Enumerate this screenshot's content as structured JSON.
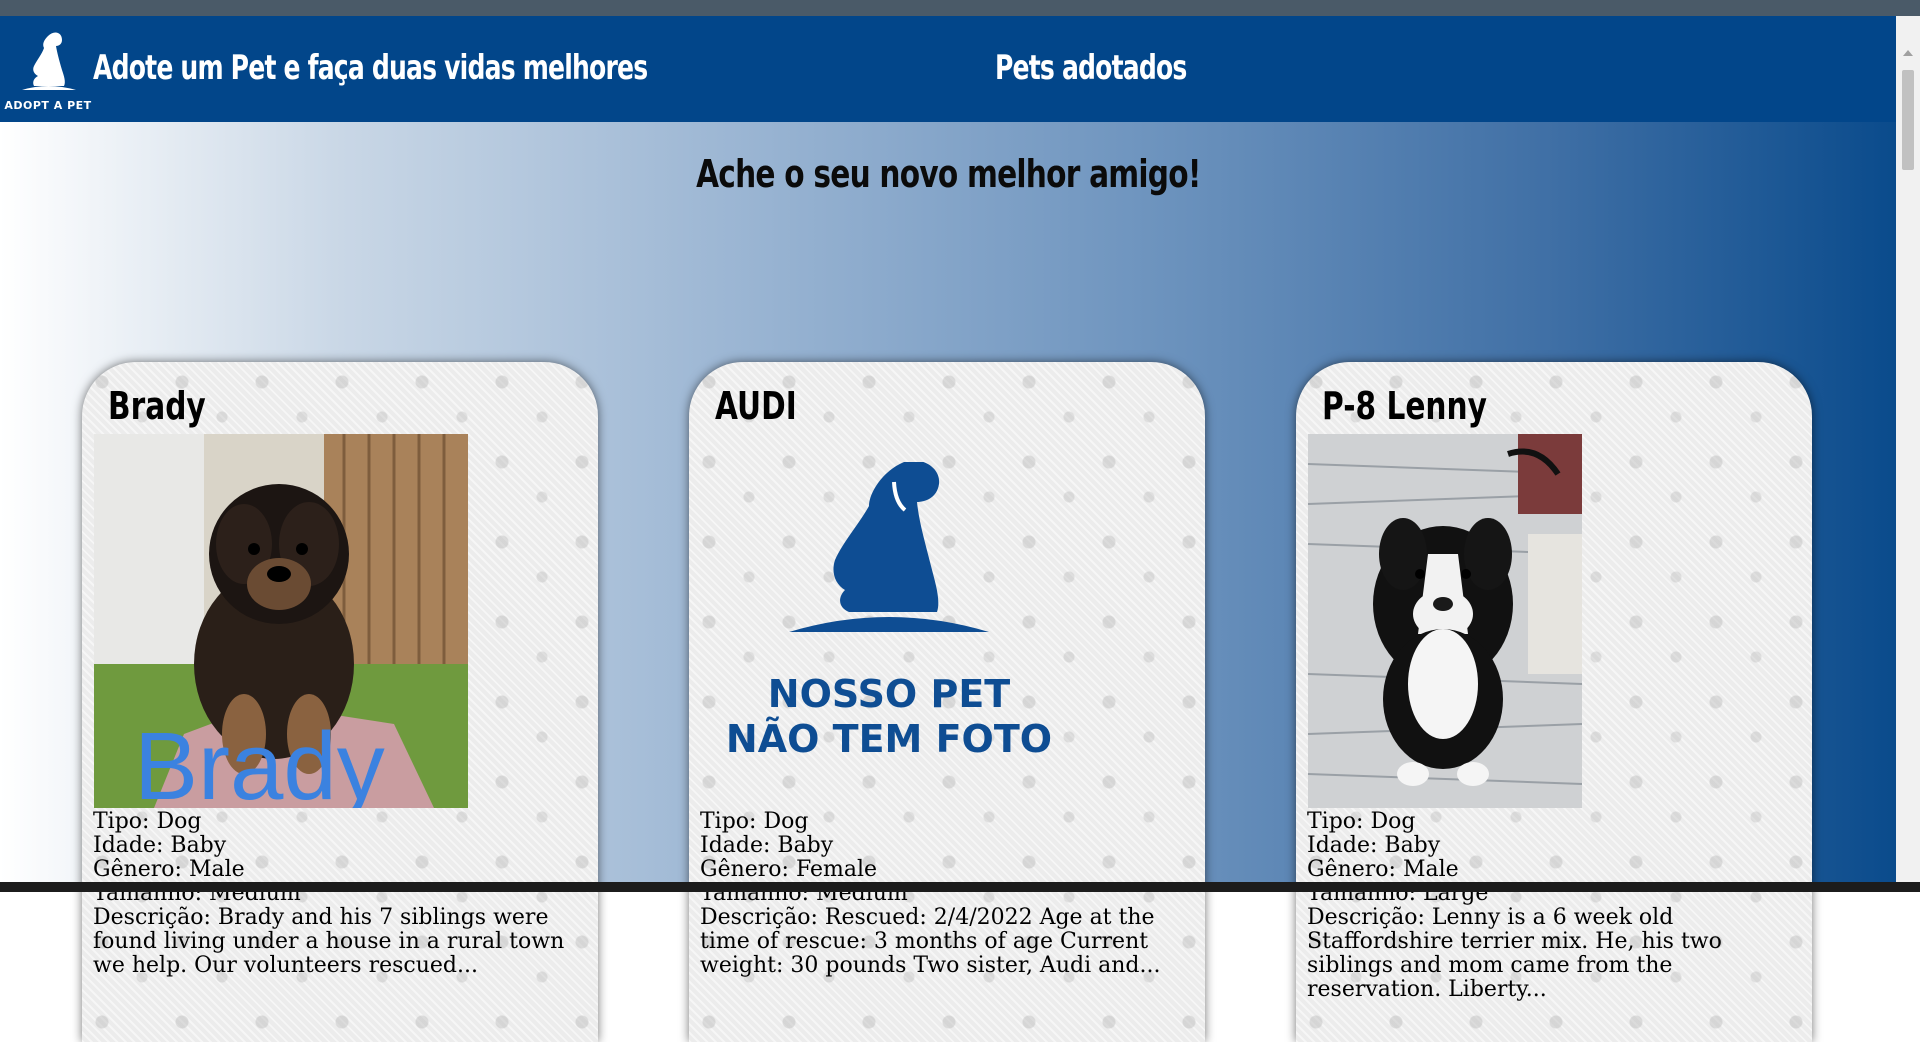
{
  "header": {
    "logo_text": "ADOPT A PET",
    "title": "Adote um Pet e faça duas vidas melhores",
    "adopted_link": "Pets adotados"
  },
  "main": {
    "heading": "Ache o seu novo melhor amigo!"
  },
  "placeholder_text": {
    "line1": "NOSSO PET",
    "line2": "NÃO TEM FOTO"
  },
  "photo_caption_1": "Brady",
  "cards": [
    {
      "name": "Brady",
      "tipo": "Tipo: Dog",
      "idade": "Idade: Baby",
      "genero": "Gênero: Male",
      "tamanho": "Tamanho: Medium",
      "descricao": "Descrição: Brady and his 7 siblings were found living under a house in a rural town we help. Our volunteers rescued..."
    },
    {
      "name": "AUDI",
      "tipo": "Tipo: Dog",
      "idade": "Idade: Baby",
      "genero": "Gênero: Female",
      "tamanho": "Tamanho: Medium",
      "descricao": "Descrição: Rescued: 2/4/2022 Age at the time of rescue: 3 months of age Current weight: 30 pounds Two sister, Audi and..."
    },
    {
      "name": "P-8 Lenny",
      "tipo": "Tipo: Dog",
      "idade": "Idade: Baby",
      "genero": "Gênero: Male",
      "tamanho": "Tamanho: Large",
      "descricao": "Descrição: Lenny is a 6 week old Staffordshire terrier mix. He, his two siblings and mom came from the reservation. Liberty..."
    }
  ],
  "colors": {
    "header_bg": "#02468a",
    "brand_blue": "#0e4d93"
  }
}
